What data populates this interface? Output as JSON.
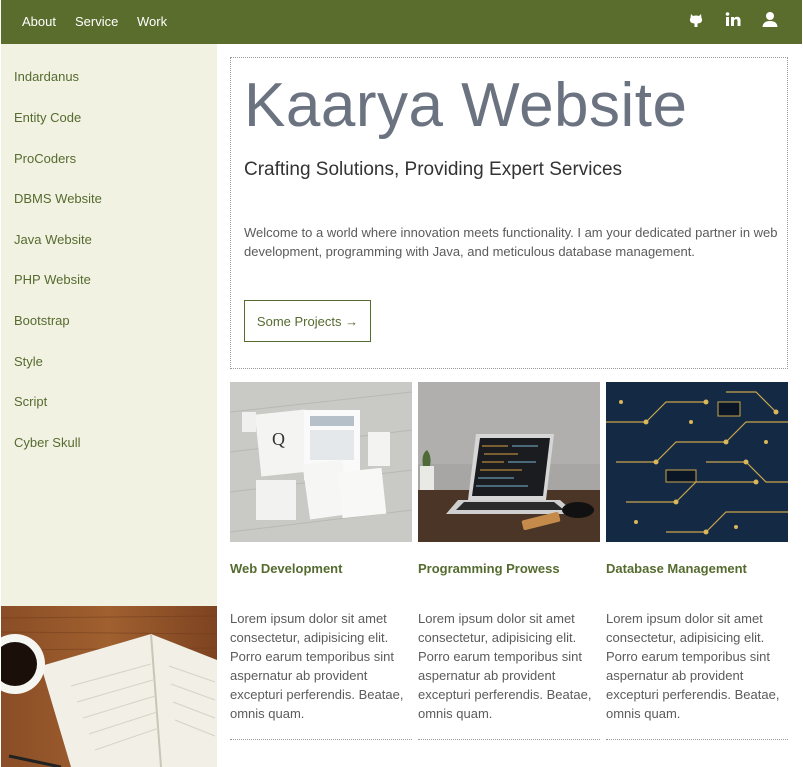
{
  "nav": {
    "links": [
      "About",
      "Service",
      "Work"
    ],
    "icons": [
      "github-icon",
      "linkedin-icon",
      "user-icon"
    ]
  },
  "sidebar": {
    "items": [
      "Indardanus",
      "Entity Code",
      "ProCoders",
      "DBMS Website",
      "Java Website",
      "PHP Website",
      "Bootstrap",
      "Style",
      "Script",
      "Cyber Skull"
    ]
  },
  "hero": {
    "title": "Kaarya Website",
    "subtitle": "Crafting Solutions, Providing Expert Services",
    "text": "Welcome to a world where innovation meets functionality. I am your dedicated partner in web development, programming with Java, and meticulous database management.",
    "button_label": "Some Projects →"
  },
  "cards": [
    {
      "title": "Web Development",
      "text": "Lorem ipsum dolor sit amet consectetur, adipisicing elit. Porro earum temporibus sint aspernatur ab provident excepturi perferendis. Beatae, omnis quam."
    },
    {
      "title": "Programming Prowess",
      "text": "Lorem ipsum dolor sit amet consectetur, adipisicing elit. Porro earum temporibus sint aspernatur ab provident excepturi perferendis. Beatae, omnis quam."
    },
    {
      "title": "Database Management",
      "text": "Lorem ipsum dolor sit amet consectetur, adipisicing elit. Porro earum temporibus sint aspernatur ab provident excepturi perferendis. Beatae, omnis quam."
    }
  ],
  "colors": {
    "nav_bg": "#5a6d2d",
    "accent": "#556b2f",
    "sidebar_bg": "#f2f2e3"
  }
}
